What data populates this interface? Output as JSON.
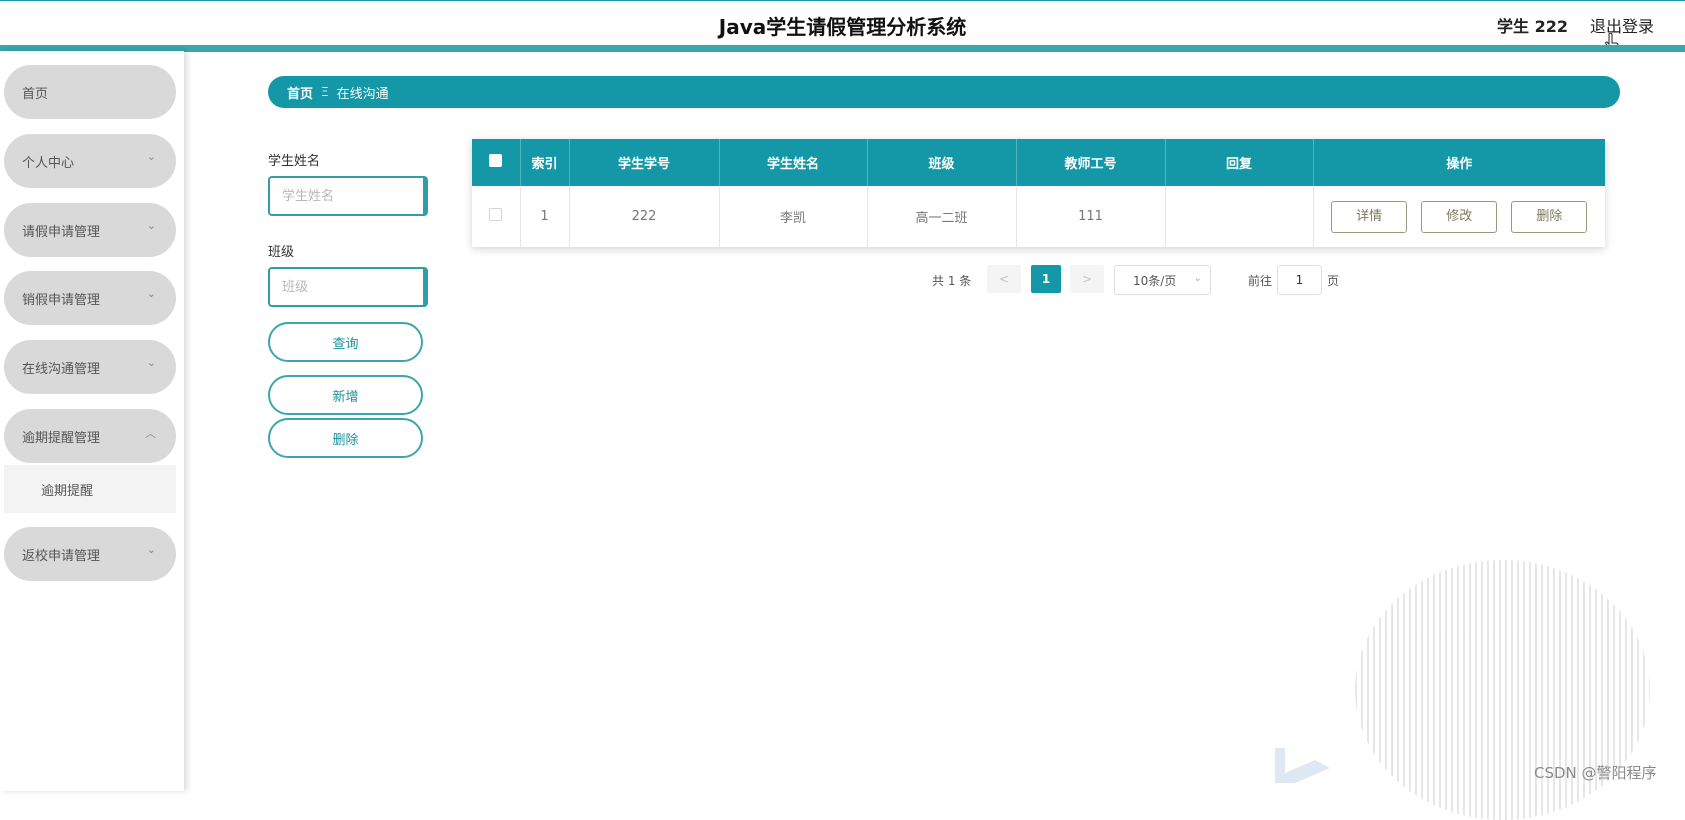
{
  "header": {
    "title": "Java学生请假管理分析系统",
    "user": "学生 222",
    "logout": "退出登录"
  },
  "sidebar": {
    "items": [
      {
        "label": "首页",
        "chevron": ""
      },
      {
        "label": "个人中心",
        "chevron": "⌄"
      },
      {
        "label": "请假申请管理",
        "chevron": "⌄"
      },
      {
        "label": "销假申请管理",
        "chevron": "⌄"
      },
      {
        "label": "在线沟通管理",
        "chevron": "⌄"
      },
      {
        "label": "逾期提醒管理",
        "chevron": "︿"
      },
      {
        "label": "逾期提醒",
        "chevron": ""
      },
      {
        "label": "返校申请管理",
        "chevron": "⌄"
      }
    ]
  },
  "breadcrumb": {
    "home": "首页",
    "separator": "Ξ",
    "current": "在线沟通"
  },
  "search": {
    "name_label": "学生姓名",
    "name_placeholder": "学生姓名",
    "class_label": "班级",
    "class_placeholder": "班级",
    "query_btn": "查询",
    "add_btn": "新增",
    "delete_btn": "删除"
  },
  "table": {
    "headers": [
      "索引",
      "学生学号",
      "学生姓名",
      "班级",
      "教师工号",
      "回复",
      "操作"
    ],
    "rows": [
      {
        "index": "1",
        "student_id": "222",
        "student_name": "李凯",
        "class": "高一二班",
        "teacher_id": "111",
        "reply": ""
      }
    ],
    "actions": {
      "detail": "详情",
      "edit": "修改",
      "delete": "删除"
    }
  },
  "pagination": {
    "total": "共 1 条",
    "prev": "<",
    "current": "1",
    "next": ">",
    "page_size": "10条/页",
    "goto_label": "前往",
    "goto_value": "1",
    "goto_unit": "页"
  },
  "watermark": {
    "text": "CSDN @警阳程序"
  },
  "colors": {
    "primary": "#1497a6",
    "sidebar_item_bg": "#d9d9d9",
    "header_accent": "#3aa6ae"
  }
}
